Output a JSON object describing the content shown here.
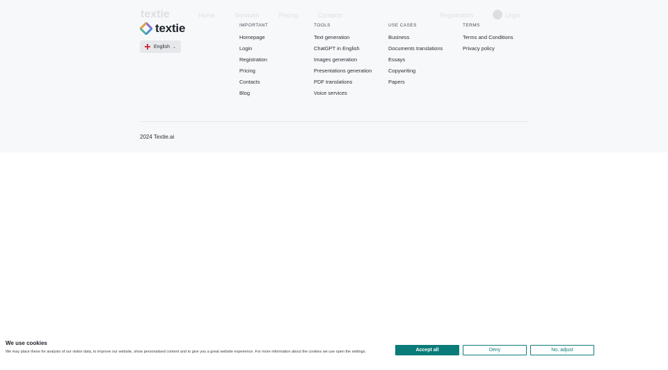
{
  "ghost_header": {
    "logo": "textie",
    "nav": [
      "Home",
      "Services",
      "Pricing",
      "Contacts"
    ],
    "right": [
      "Registration",
      "Login"
    ]
  },
  "brand": {
    "name": "textie",
    "colors": [
      "#4fb39a",
      "#8a6fd1",
      "#e8a04a",
      "#4b8fd6"
    ]
  },
  "language": {
    "selected": "English",
    "flag": "england-flag-icon"
  },
  "columns": [
    {
      "heading": "IMPORTANT",
      "items": [
        "Homepage",
        "Login",
        "Registration",
        "Pricing",
        "Contacts",
        "Blog"
      ]
    },
    {
      "heading": "TOOLS",
      "items": [
        "Text generation",
        "ChatGPT in English",
        "Images generation",
        "Presentations generation",
        "PDF translations",
        "Voice services"
      ]
    },
    {
      "heading": "USE CASES",
      "items": [
        "Business",
        "Documents translations",
        "Essays",
        "Copywriting",
        "Papers"
      ]
    },
    {
      "heading": "TERMS",
      "items": [
        "Terms and Conditions",
        "Privacy policy"
      ]
    }
  ],
  "copyright": "2024 Textie.ai",
  "cookie": {
    "title": "We use cookies",
    "text": "We may place these for analysis of our visitor data, to improve our website, show personalised content and to give you a great website experience. For more information about the cookies we use open the settings.",
    "accept": "Accept all",
    "deny": "Deny",
    "adjust": "No, adjust",
    "accent": "#0b7b79"
  }
}
